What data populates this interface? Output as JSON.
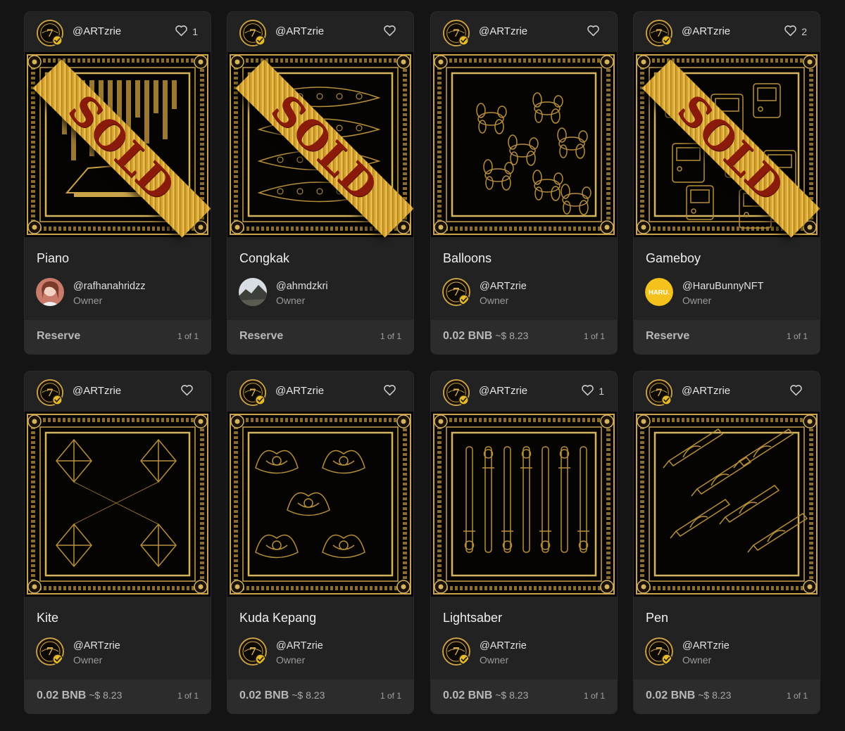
{
  "cards": [
    {
      "creator": "@ARTzrie",
      "likes": "1",
      "title": "Piano",
      "owner": "@rafhanahridzz",
      "owner_role": "Owner",
      "price": "Reserve",
      "usd": "",
      "edition": "1 of 1",
      "sold": true,
      "sold_label": "SOLD",
      "owner_avatar": "photo-female"
    },
    {
      "creator": "@ARTzrie",
      "likes": "",
      "title": "Congkak",
      "owner": "@ahmdzkri",
      "owner_role": "Owner",
      "price": "Reserve",
      "usd": "",
      "edition": "1 of 1",
      "sold": true,
      "sold_label": "SOLD",
      "owner_avatar": "photo-landscape"
    },
    {
      "creator": "@ARTzrie",
      "likes": "",
      "title": "Balloons",
      "owner": "@ARTzrie",
      "owner_role": "Owner",
      "price": "0.02 BNB",
      "usd": "~$ 8.23",
      "edition": "1 of 1",
      "sold": false,
      "owner_avatar": "artzrie-logo"
    },
    {
      "creator": "@ARTzrie",
      "likes": "2",
      "title": "Gameboy",
      "owner": "@HaruBunnyNFT",
      "owner_role": "Owner",
      "price": "Reserve",
      "usd": "",
      "edition": "1 of 1",
      "sold": true,
      "sold_label": "SOLD",
      "owner_avatar": "haru-logo",
      "owner_avatar_text": "HARU."
    },
    {
      "creator": "@ARTzrie",
      "likes": "",
      "title": "Kite",
      "owner": "@ARTzrie",
      "owner_role": "Owner",
      "price": "0.02 BNB",
      "usd": "~$ 8.23",
      "edition": "1 of 1",
      "sold": false,
      "owner_avatar": "artzrie-logo"
    },
    {
      "creator": "@ARTzrie",
      "likes": "",
      "title": "Kuda Kepang",
      "owner": "@ARTzrie",
      "owner_role": "Owner",
      "price": "0.02 BNB",
      "usd": "~$ 8.23",
      "edition": "1 of 1",
      "sold": false,
      "owner_avatar": "artzrie-logo"
    },
    {
      "creator": "@ARTzrie",
      "likes": "1",
      "title": "Lightsaber",
      "owner": "@ARTzrie",
      "owner_role": "Owner",
      "price": "0.02 BNB",
      "usd": "~$ 8.23",
      "edition": "1 of 1",
      "sold": false,
      "owner_avatar": "artzrie-logo"
    },
    {
      "creator": "@ARTzrie",
      "likes": "",
      "title": "Pen",
      "owner": "@ARTzrie",
      "owner_role": "Owner",
      "price": "0.02 BNB",
      "usd": "~$ 8.23",
      "edition": "1 of 1",
      "sold": false,
      "owner_avatar": "artzrie-logo"
    }
  ],
  "colors": {
    "background": "#141414",
    "card": "#222222",
    "footer": "#2c2c2c",
    "gold": "#c9a24a",
    "verified": "#e8b928",
    "sold_text": "#8a1b0a"
  }
}
